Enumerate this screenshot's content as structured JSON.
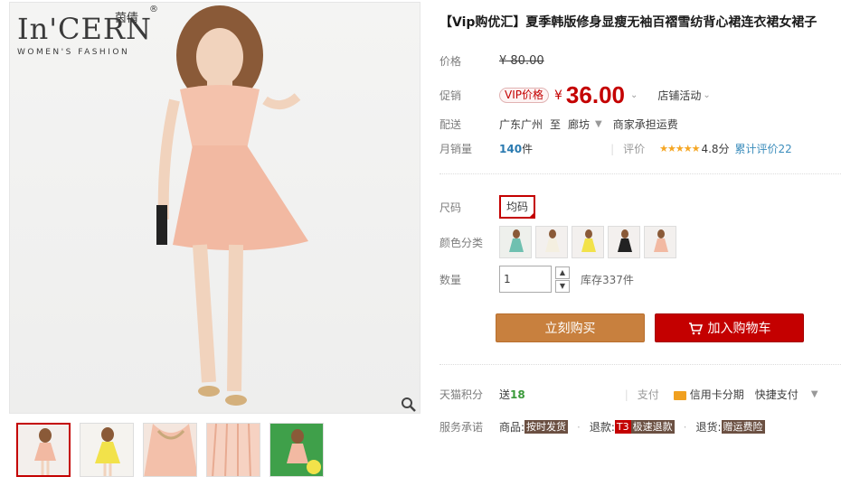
{
  "brand": {
    "logo": "In'CERN",
    "cn": "茵倩",
    "reg": "®",
    "tagline": "WOMEN'S FASHION"
  },
  "title": "【Vip购优汇】夏季韩版修身显瘦无袖百褶雪纺背心裙连衣裙女裙子",
  "price_row": {
    "label": "价格",
    "original": "¥ 80.00"
  },
  "promo_row": {
    "label": "促销",
    "vip": "VIP价格",
    "yen": "¥",
    "price": "36.00",
    "store_event": "店铺活动"
  },
  "shipping_row": {
    "label": "配送",
    "from": "广东广州",
    "to_word": "至",
    "dest": "廊坊",
    "fee": "商家承担运费"
  },
  "sales_row": {
    "label": "月销量",
    "count": "140",
    "unit": "件",
    "review_label": "评价",
    "stars": "★★★★★",
    "score": "4.8分",
    "total_reviews": "累计评价22"
  },
  "size_row": {
    "label": "尺码",
    "option": "均码"
  },
  "color_row": {
    "label": "颜色分类",
    "swatch_count": 5
  },
  "qty_row": {
    "label": "数量",
    "value": "1",
    "up": "▲",
    "down": "▼",
    "stock": "库存337件"
  },
  "buttons": {
    "buy": "立刻购买",
    "cart": "加入购物车"
  },
  "points_row": {
    "label": "天猫积分",
    "send": "送",
    "points": "18",
    "pay_label": "支付",
    "credit": "信用卡分期",
    "quick_pay": "快捷支付"
  },
  "service_row": {
    "label": "服务承诺",
    "goods_label": "商品:",
    "goods_tag": "按时发货",
    "refund_label": "退款:",
    "refund_t3": "T3",
    "refund_tag": "极速退款",
    "return_label": "退货:",
    "return_tag": "赠运费险"
  },
  "colors": {
    "accent": "#c40000",
    "buy_btn": "#c8803e",
    "cart_btn": "#c40000"
  }
}
